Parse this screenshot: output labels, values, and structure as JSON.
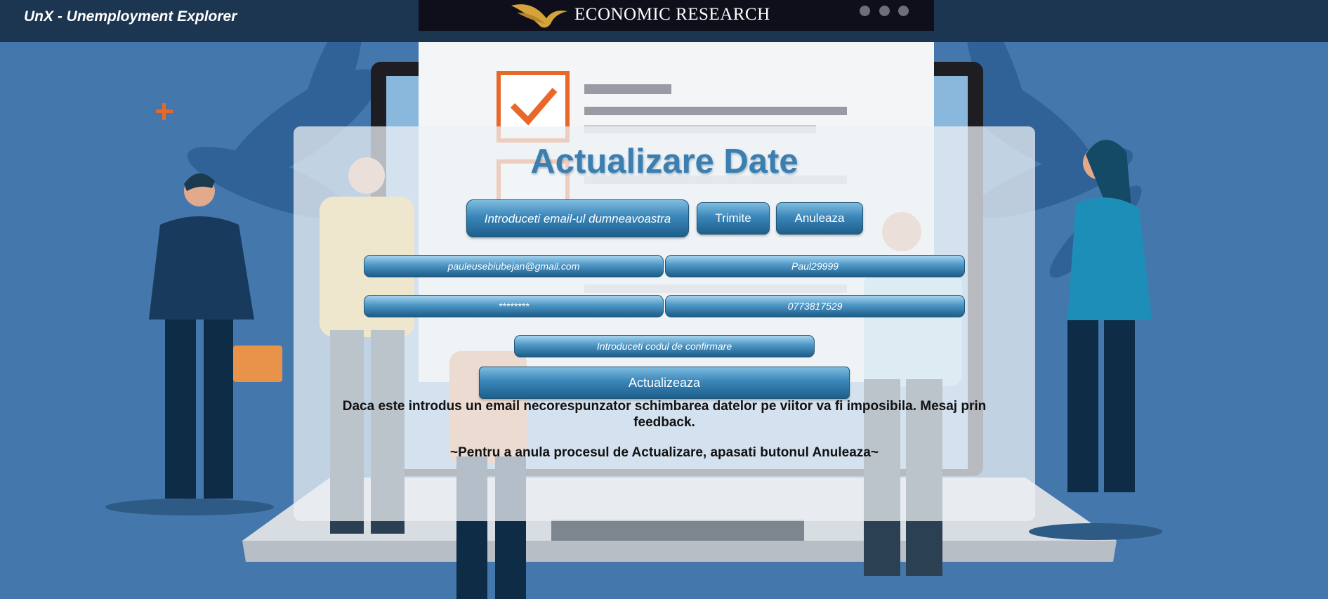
{
  "app": {
    "title": "UnX - Unemployment Explorer"
  },
  "banner": {
    "title": "ECONOMIC RESEARCH"
  },
  "form": {
    "title": "Actualizare Date",
    "email_prompt": "Introduceti email-ul dumneavoastra",
    "send_label": "Trimite",
    "cancel_label": "Anuleaza",
    "email_value": "pauleusebiubejan@gmail.com",
    "username_value": "Paul29999",
    "password_value": "********",
    "phone_value": "0773817529",
    "code_placeholder": "Introduceti codul de confirmare",
    "update_label": "Actualizeaza",
    "warning": "Daca este introdus un email necorespunzator schimbarea datelor pe viitor va fi imposibila. Mesaj prin feedback.",
    "cancel_hint": "~Pentru a anula procesul de Actualizare, apasati butonul Anuleaza~"
  },
  "colors": {
    "background": "#4478ad",
    "navbar": "#1c3550",
    "title": "#3a7fb0",
    "button": "#2f78ab"
  }
}
